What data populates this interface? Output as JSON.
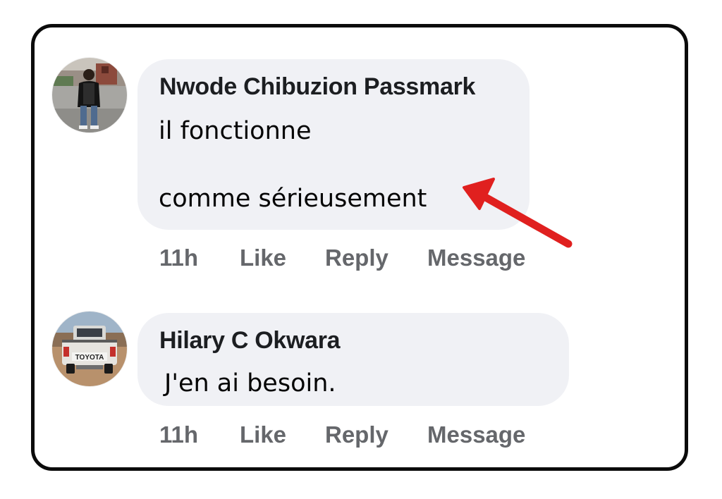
{
  "comments": [
    {
      "author": "Nwode Chibuzion Passmark",
      "text_lines": [
        "il fonctionne",
        "comme sérieusement"
      ],
      "avatar_icon": "person-standing-photo",
      "actions": {
        "time": "11h",
        "like": "Like",
        "reply": "Reply",
        "message": "Message"
      }
    },
    {
      "author": "Hilary C Okwara",
      "text_lines": [
        "J'en ai besoin."
      ],
      "avatar_icon": "pickup-truck-photo",
      "avatar_caption": "TOYOTA",
      "actions": {
        "time": "11h",
        "like": "Like",
        "reply": "Reply",
        "message": "Message"
      }
    }
  ],
  "annotation": {
    "icon": "red-arrow",
    "color": "#e0201f"
  },
  "colors": {
    "bubble": "#f0f1f5",
    "author_text": "#1c1e21",
    "action_text": "#65676b",
    "frame_border": "#0b0b0b"
  }
}
